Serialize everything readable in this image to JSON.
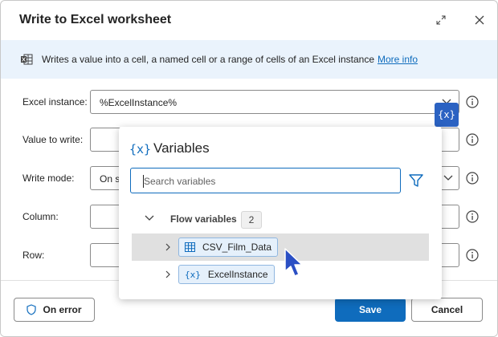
{
  "dialog": {
    "title": "Write to Excel worksheet",
    "banner_text": "Writes a value into a cell, a named cell or a range of cells of an Excel instance",
    "banner_link": "More info"
  },
  "fields": {
    "excel_instance_label": "Excel instance:",
    "excel_instance_value": "%ExcelInstance%",
    "value_label": "Value to write:",
    "write_mode_label": "Write mode:",
    "write_mode_value": "On s",
    "column_label": "Column:",
    "row_label": "Row:"
  },
  "variables_button": "{x}",
  "popup": {
    "icon": "{x}",
    "title": "Variables",
    "search_placeholder": "Search variables",
    "group_label": "Flow variables",
    "group_count": "2",
    "items": [
      {
        "label": "CSV_Film_Data",
        "icon": "table-icon"
      },
      {
        "label": "ExcelInstance",
        "icon": "{x}"
      }
    ]
  },
  "footer": {
    "on_error": "On error",
    "save": "Save",
    "cancel": "Cancel"
  },
  "colors": {
    "accent": "#0f6cbd",
    "banner_bg": "#eaf3fc",
    "variables_button": "#2b62c2",
    "chip_bg": "#e5f0fb"
  }
}
